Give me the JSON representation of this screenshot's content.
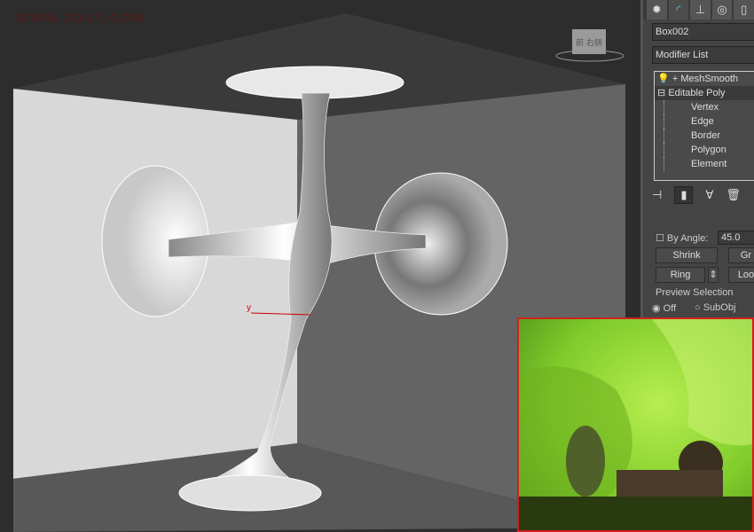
{
  "watermark": "WWW.3DXY.COM",
  "viewport": {
    "axis_label": "y",
    "viewcube_label": "前 右侧"
  },
  "panel": {
    "tabs": [
      {
        "icon": "sun-icon"
      },
      {
        "icon": "modify-icon"
      },
      {
        "icon": "hierarchy-icon"
      },
      {
        "icon": "motion-icon"
      },
      {
        "icon": "display-icon"
      }
    ],
    "object_name": "Box002",
    "modifier_list": "Modifier List",
    "stack": [
      {
        "label": "MeshSmooth",
        "prefix": "+"
      },
      {
        "label": "Editable Poly",
        "prefix": "−"
      },
      {
        "label": "Vertex"
      },
      {
        "label": "Edge"
      },
      {
        "label": "Border"
      },
      {
        "label": "Polygon"
      },
      {
        "label": "Element"
      }
    ],
    "by_angle_label": "By Angle:",
    "by_angle_value": "45.0",
    "shrink": "Shrink",
    "grow": "Gr",
    "ring": "Ring",
    "loop": "Loo",
    "preview_selection": "Preview Selection",
    "preview_options": [
      "Off",
      "SubObj"
    ],
    "preview_selected": "Off"
  },
  "colors": {
    "accent_border": "#d02020",
    "photo_green": "#9ee040"
  }
}
